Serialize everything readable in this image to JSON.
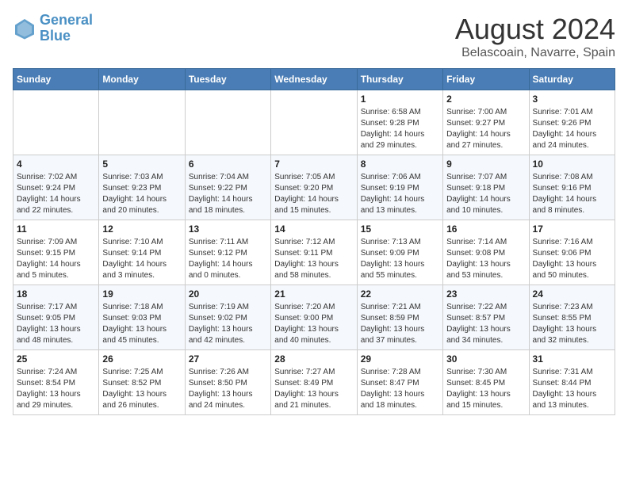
{
  "header": {
    "logo_line1": "General",
    "logo_line2": "Blue",
    "month": "August 2024",
    "location": "Belascoain, Navarre, Spain"
  },
  "weekdays": [
    "Sunday",
    "Monday",
    "Tuesday",
    "Wednesday",
    "Thursday",
    "Friday",
    "Saturday"
  ],
  "weeks": [
    [
      {
        "day": "",
        "info": ""
      },
      {
        "day": "",
        "info": ""
      },
      {
        "day": "",
        "info": ""
      },
      {
        "day": "",
        "info": ""
      },
      {
        "day": "1",
        "info": "Sunrise: 6:58 AM\nSunset: 9:28 PM\nDaylight: 14 hours\nand 29 minutes."
      },
      {
        "day": "2",
        "info": "Sunrise: 7:00 AM\nSunset: 9:27 PM\nDaylight: 14 hours\nand 27 minutes."
      },
      {
        "day": "3",
        "info": "Sunrise: 7:01 AM\nSunset: 9:26 PM\nDaylight: 14 hours\nand 24 minutes."
      }
    ],
    [
      {
        "day": "4",
        "info": "Sunrise: 7:02 AM\nSunset: 9:24 PM\nDaylight: 14 hours\nand 22 minutes."
      },
      {
        "day": "5",
        "info": "Sunrise: 7:03 AM\nSunset: 9:23 PM\nDaylight: 14 hours\nand 20 minutes."
      },
      {
        "day": "6",
        "info": "Sunrise: 7:04 AM\nSunset: 9:22 PM\nDaylight: 14 hours\nand 18 minutes."
      },
      {
        "day": "7",
        "info": "Sunrise: 7:05 AM\nSunset: 9:20 PM\nDaylight: 14 hours\nand 15 minutes."
      },
      {
        "day": "8",
        "info": "Sunrise: 7:06 AM\nSunset: 9:19 PM\nDaylight: 14 hours\nand 13 minutes."
      },
      {
        "day": "9",
        "info": "Sunrise: 7:07 AM\nSunset: 9:18 PM\nDaylight: 14 hours\nand 10 minutes."
      },
      {
        "day": "10",
        "info": "Sunrise: 7:08 AM\nSunset: 9:16 PM\nDaylight: 14 hours\nand 8 minutes."
      }
    ],
    [
      {
        "day": "11",
        "info": "Sunrise: 7:09 AM\nSunset: 9:15 PM\nDaylight: 14 hours\nand 5 minutes."
      },
      {
        "day": "12",
        "info": "Sunrise: 7:10 AM\nSunset: 9:14 PM\nDaylight: 14 hours\nand 3 minutes."
      },
      {
        "day": "13",
        "info": "Sunrise: 7:11 AM\nSunset: 9:12 PM\nDaylight: 14 hours\nand 0 minutes."
      },
      {
        "day": "14",
        "info": "Sunrise: 7:12 AM\nSunset: 9:11 PM\nDaylight: 13 hours\nand 58 minutes."
      },
      {
        "day": "15",
        "info": "Sunrise: 7:13 AM\nSunset: 9:09 PM\nDaylight: 13 hours\nand 55 minutes."
      },
      {
        "day": "16",
        "info": "Sunrise: 7:14 AM\nSunset: 9:08 PM\nDaylight: 13 hours\nand 53 minutes."
      },
      {
        "day": "17",
        "info": "Sunrise: 7:16 AM\nSunset: 9:06 PM\nDaylight: 13 hours\nand 50 minutes."
      }
    ],
    [
      {
        "day": "18",
        "info": "Sunrise: 7:17 AM\nSunset: 9:05 PM\nDaylight: 13 hours\nand 48 minutes."
      },
      {
        "day": "19",
        "info": "Sunrise: 7:18 AM\nSunset: 9:03 PM\nDaylight: 13 hours\nand 45 minutes."
      },
      {
        "day": "20",
        "info": "Sunrise: 7:19 AM\nSunset: 9:02 PM\nDaylight: 13 hours\nand 42 minutes."
      },
      {
        "day": "21",
        "info": "Sunrise: 7:20 AM\nSunset: 9:00 PM\nDaylight: 13 hours\nand 40 minutes."
      },
      {
        "day": "22",
        "info": "Sunrise: 7:21 AM\nSunset: 8:59 PM\nDaylight: 13 hours\nand 37 minutes."
      },
      {
        "day": "23",
        "info": "Sunrise: 7:22 AM\nSunset: 8:57 PM\nDaylight: 13 hours\nand 34 minutes."
      },
      {
        "day": "24",
        "info": "Sunrise: 7:23 AM\nSunset: 8:55 PM\nDaylight: 13 hours\nand 32 minutes."
      }
    ],
    [
      {
        "day": "25",
        "info": "Sunrise: 7:24 AM\nSunset: 8:54 PM\nDaylight: 13 hours\nand 29 minutes."
      },
      {
        "day": "26",
        "info": "Sunrise: 7:25 AM\nSunset: 8:52 PM\nDaylight: 13 hours\nand 26 minutes."
      },
      {
        "day": "27",
        "info": "Sunrise: 7:26 AM\nSunset: 8:50 PM\nDaylight: 13 hours\nand 24 minutes."
      },
      {
        "day": "28",
        "info": "Sunrise: 7:27 AM\nSunset: 8:49 PM\nDaylight: 13 hours\nand 21 minutes."
      },
      {
        "day": "29",
        "info": "Sunrise: 7:28 AM\nSunset: 8:47 PM\nDaylight: 13 hours\nand 18 minutes."
      },
      {
        "day": "30",
        "info": "Sunrise: 7:30 AM\nSunset: 8:45 PM\nDaylight: 13 hours\nand 15 minutes."
      },
      {
        "day": "31",
        "info": "Sunrise: 7:31 AM\nSunset: 8:44 PM\nDaylight: 13 hours\nand 13 minutes."
      }
    ]
  ]
}
